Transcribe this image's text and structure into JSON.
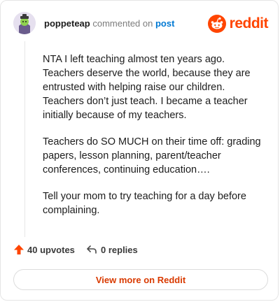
{
  "comment": {
    "username": "poppeteap",
    "action_text": "commented on",
    "post_link_label": "post",
    "paragraphs": [
      "NTA I left teaching almost ten years ago. Teachers deserve the world, because they are entrusted with helping raise our children. Teachers don’t just teach. I became a teacher initially because of my teachers.",
      "Teachers do SO MUCH on their time off: grading papers, lesson planning, parent/teacher conferences, continuing education….",
      "Tell your mom to try teaching for a day before complaining."
    ]
  },
  "brand": {
    "wordmark": "reddit",
    "icon": "reddit-snoo-icon",
    "color": "#ff4500"
  },
  "actions": {
    "upvotes_label": "40 upvotes",
    "upvote_icon": "upvote-arrow-icon",
    "replies_label": "0 replies",
    "reply_icon": "reply-arrow-icon"
  },
  "footer": {
    "view_more_label": "View more on Reddit",
    "link_color": "#d93a00"
  }
}
